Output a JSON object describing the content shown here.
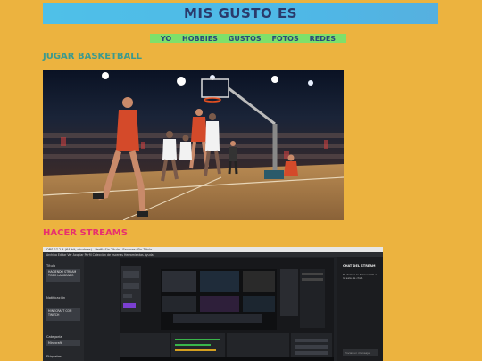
{
  "header": {
    "title": "MIS GUSTO ES"
  },
  "nav": {
    "items": [
      "YO",
      "HOBBIES",
      "GUSTOS",
      "FOTOS",
      "REDES"
    ]
  },
  "sections": [
    {
      "title": "JUGAR BASKETBALL"
    },
    {
      "title": "HACER STREAMS"
    }
  ],
  "obs": {
    "window_title": "OBS 27.2.4 (64-bit, windows) - Perfil: Sin Título - Escenas: Sin Título",
    "menu": "Archivo  Editar  Ver  Acoplar  Perfil  Colección de escenas  Herramientas  Ayuda",
    "left_panel": {
      "title_label": "Título",
      "title_value": "HACIENDO STREAM TODO LAGGEADO",
      "notification_label": "Notificación",
      "notification_value": "MINECRAFT CON TWITCH",
      "category_label": "Categoría",
      "category_value": "Minecraft",
      "tags_label": "Etiquetas"
    },
    "chat": {
      "title": "CHAT DEL STREAM",
      "welcome": "Te damos la bienvenida a la sala de chat.",
      "input_placeholder": "Enviar un mensaje"
    }
  },
  "colors": {
    "page_background": "#ecb33f",
    "header_banner": "#4fc0e8",
    "nav_background": "#7fe06a",
    "section1_title": "#3c9a8e",
    "section2_title": "#e8306e"
  }
}
